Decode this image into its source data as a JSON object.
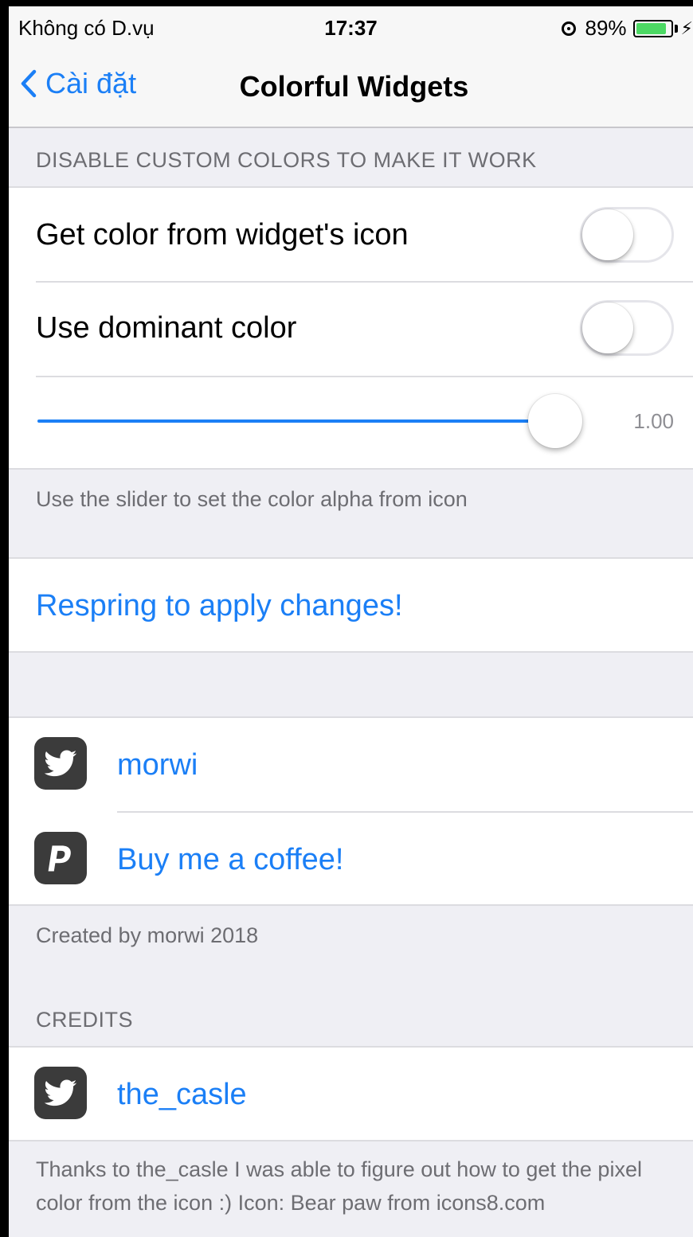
{
  "status_bar": {
    "carrier": "Không có D.vụ",
    "time": "17:37",
    "battery_percent": "89%",
    "battery_level": 0.89
  },
  "nav": {
    "back_label": "Cài đặt",
    "title": "Colorful Widgets"
  },
  "colors": {
    "accent": "#1b7ff6",
    "background": "#efeff4",
    "battery": "#4cd964"
  },
  "section1": {
    "header": "DISABLE CUSTOM COLORS TO MAKE IT WORK",
    "toggle_icon_label": "Get color from widget's icon",
    "toggle_icon_on": false,
    "toggle_dominant_label": "Use dominant color",
    "toggle_dominant_on": false,
    "slider_value_text": "1.00",
    "slider_value": 1.0,
    "footer": "Use the slider to set the color alpha from icon"
  },
  "respring": {
    "label": "Respring to apply changes!"
  },
  "links": {
    "twitter_label": "morwi",
    "twitter_icon": "twitter-icon",
    "paypal_label": "Buy me a coffee!",
    "paypal_icon": "paypal-icon",
    "footer": "Created by morwi 2018"
  },
  "credits": {
    "header": "CREDITS",
    "twitter_label": "the_casle",
    "footer": "Thanks to the_casle I was able to figure out how to get the pixel color from the icon :) Icon: Bear paw from icons8.com"
  }
}
